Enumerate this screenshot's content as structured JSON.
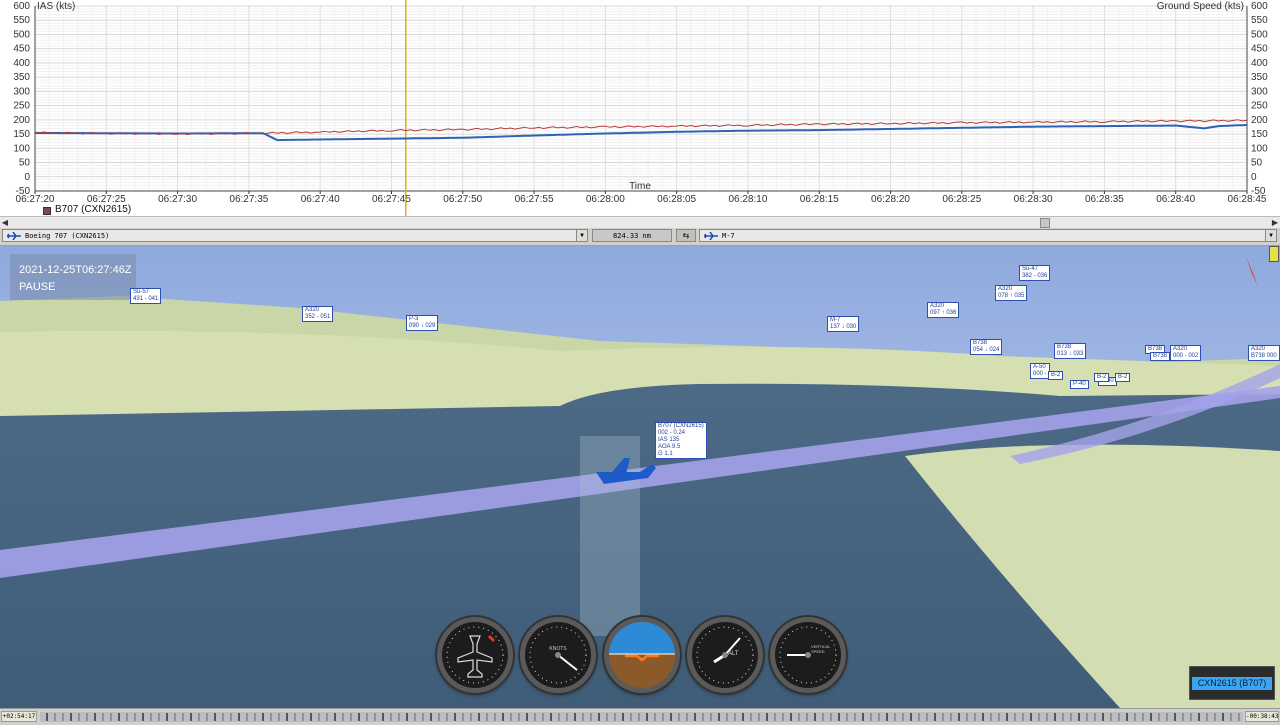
{
  "chart_data": {
    "type": "line",
    "title": "",
    "xlabel": "Time",
    "ylabel": "IAS (kts)",
    "y2label": "Ground Speed (kts)",
    "ylim": [
      -50,
      600
    ],
    "yticks": [
      -50,
      0,
      50,
      100,
      150,
      200,
      250,
      300,
      350,
      400,
      450,
      500,
      550,
      600
    ],
    "x_ticks": [
      "06:27:20",
      "06:27:25",
      "06:27:30",
      "06:27:35",
      "06:27:40",
      "06:27:45",
      "06:27:50",
      "06:27:55",
      "06:28:00",
      "06:28:05",
      "06:28:10",
      "06:28:15",
      "06:28:20",
      "06:28:25",
      "06:28:30",
      "06:28:35",
      "06:28:40",
      "06:28:45"
    ],
    "cursor_time": "06:27:46",
    "grid": true,
    "legend": "B707 (CXN2615)",
    "series": [
      {
        "name": "IAS (kts)",
        "color": "#2e63b5",
        "t": [
          0,
          5,
          10,
          15,
          16,
          17,
          20,
          25,
          30,
          35,
          40,
          45,
          50,
          55,
          60,
          65,
          70,
          75,
          80,
          82,
          83,
          85
        ],
        "values": [
          154,
          153,
          152,
          153,
          153,
          129,
          131,
          134,
          137,
          145,
          152,
          158,
          162,
          164,
          168,
          172,
          176,
          178,
          180,
          170,
          178,
          182
        ]
      },
      {
        "name": "Ground Speed (kts)",
        "color": "#b23a3a",
        "t": [
          0,
          5,
          10,
          15,
          20,
          25,
          30,
          35,
          40,
          45,
          50,
          55,
          60,
          65,
          70,
          75,
          80,
          85
        ],
        "values": [
          155,
          152,
          151,
          152,
          157,
          163,
          166,
          172,
          175,
          178,
          181,
          185,
          187,
          190,
          192,
          194,
          196,
          198
        ]
      }
    ]
  },
  "legend_label": "B707 (CXN2615)",
  "toolbar": {
    "left_aircraft": "Boeing 707 (CXN2615)",
    "distance": "824.33 nm",
    "right_aircraft": "M-7"
  },
  "scene": {
    "timestamp": "2021-12-25T06:27:46Z",
    "state": "PAUSE",
    "main_label": [
      "B707 (CXN2615)",
      "002 - 0.24",
      "IAS 135",
      "AOA 9.5",
      "G 1.1"
    ],
    "labels": [
      {
        "l1": "Su-57",
        "l2": "431 - 041"
      },
      {
        "l1": "A320",
        "l2": "352 - 051"
      },
      {
        "l1": "P-3",
        "l2": "090 ↓ 029"
      },
      {
        "l1": "M-7",
        "l2": "137 ↓ 030"
      },
      {
        "l1": "A320",
        "l2": "097 ↑ 036"
      },
      {
        "l1": "A320",
        "l2": "078 ↑ 035"
      },
      {
        "l1": "Su-47",
        "l2": "382 - 036"
      },
      {
        "l1": "B738",
        "l2": "054 ↓ 024"
      },
      {
        "l1": "B738",
        "l2": "013 ↓ 033"
      },
      {
        "l1": "A-50",
        "l2": "000 -"
      },
      {
        "l1": "B738",
        "l2": ""
      },
      {
        "l1": "A320",
        "l2": "000 - 002"
      },
      {
        "l1": "A320",
        "l2": "B738 000"
      }
    ],
    "small_tags": [
      "B-2",
      "P-40",
      "P-40",
      "B-2",
      "B-2",
      "B738"
    ]
  },
  "gauges": [
    {
      "name": "heading",
      "label": ""
    },
    {
      "name": "airspeed",
      "label": "KNOTS"
    },
    {
      "name": "attitude",
      "label": ""
    },
    {
      "name": "altimeter",
      "label": "ALT"
    },
    {
      "name": "vertical-speed",
      "label": "VERTICAL SPEED"
    }
  ],
  "aircraft_list": [
    "CXN2615 (B707)"
  ],
  "timeline": {
    "start": "+02:54:17",
    "end": "-00:38:43"
  }
}
